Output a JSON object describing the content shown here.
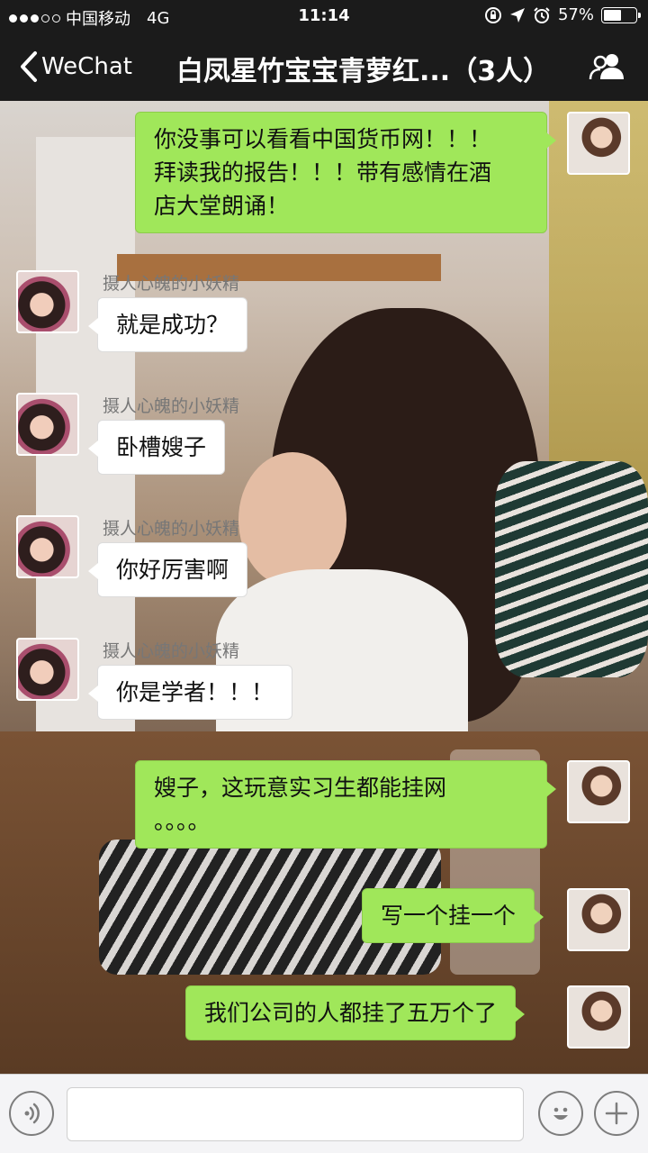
{
  "status_bar": {
    "carrier": "中国移动",
    "network": "4G",
    "time": "11:14",
    "battery_text": "57%",
    "battery_level": 0.57
  },
  "nav": {
    "back_label": "WeChat",
    "title": "白凤星竹宝宝青萝红...（3人）"
  },
  "messages": [
    {
      "from": "me",
      "text_lines": [
        "你没事可以看看中国货币网！！！",
        "拜读我的报告！！！带有感情在酒",
        "店大堂朗诵！"
      ]
    },
    {
      "from": "other",
      "sender": "摄人心魄的小妖精",
      "text": "就是成功？"
    },
    {
      "from": "other",
      "sender": "摄人心魄的小妖精",
      "text": "卧槽嫂子"
    },
    {
      "from": "other",
      "sender": "摄人心魄的小妖精",
      "text": "你好厉害啊"
    },
    {
      "from": "other",
      "sender": "摄人心魄的小妖精",
      "text": "你是学者！！！"
    },
    {
      "from": "me",
      "text_lines": [
        "嫂子，这玩意实习生都能挂网",
        "。。。。"
      ]
    },
    {
      "from": "me",
      "text": "写一个挂一个"
    },
    {
      "from": "me",
      "text": "我们公司的人都挂了五万个了"
    }
  ],
  "input": {
    "value": "",
    "placeholder": ""
  },
  "icons": {
    "back": "chevron-left-icon",
    "group": "group-members-icon",
    "voice": "voice-icon",
    "emoji": "emoji-icon",
    "add": "plus-icon"
  },
  "colors": {
    "bubble_me": "#a0e75a",
    "bubble_other": "#ffffff",
    "nav_bg": "#1b1b1b"
  }
}
